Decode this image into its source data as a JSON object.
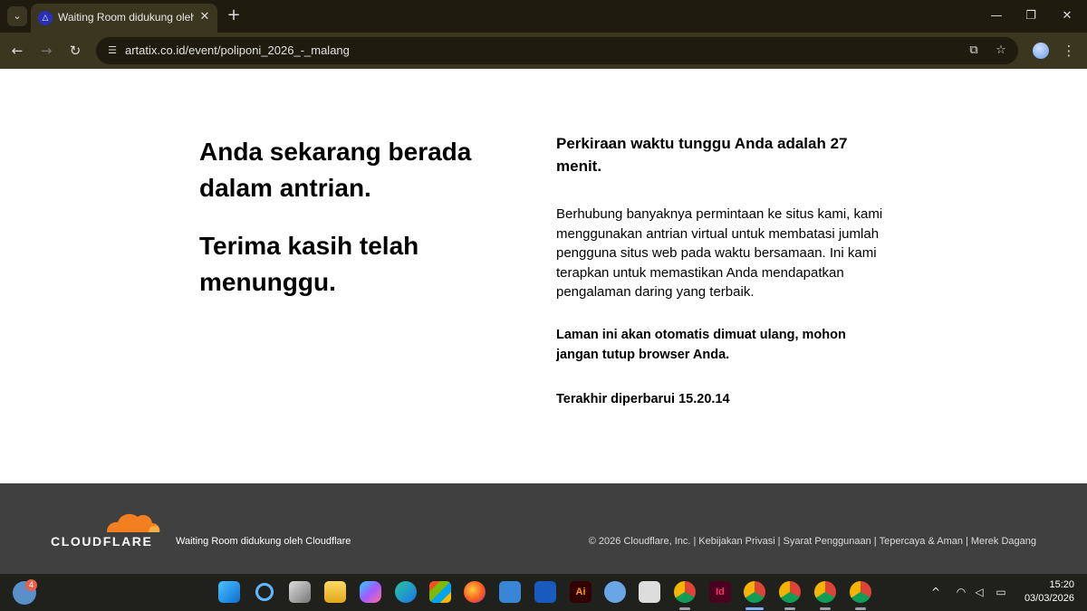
{
  "browser": {
    "tab_title": "Waiting Room didukung oleh Cloudflare",
    "url": "artatix.co.id/event/poliponi_2026_-_malang"
  },
  "page": {
    "heading_queue": "Anda sekarang berada dalam antrian.",
    "heading_thanks": "Terima kasih telah menunggu.",
    "wait_time": "Perkiraan waktu tunggu Anda adalah 27 menit.",
    "description": "Berhubung banyaknya permintaan ke situs kami, kami menggunakan antrian virtual untuk membatasi jumlah pengguna situs web pada waktu bersamaan. Ini kami terapkan untuk memastikan Anda mendapatkan pengalaman daring yang terbaik.",
    "auto_reload": "Laman ini akan otomatis dimuat ulang, mohon jangan tutup browser Anda.",
    "last_updated": "Terakhir diperbarui 15.20.14"
  },
  "footer": {
    "logo_text": "CLOUDFLARE",
    "powered_by": "Waiting Room didukung oleh Cloudflare",
    "copyright": "© 2026 Cloudflare, Inc.",
    "links": [
      "Kebijakan Privasi",
      "Syarat Penggunaan",
      "Tepercaya & Aman",
      "Merek Dagang"
    ],
    "brand_orange": "#f38020"
  },
  "taskbar": {
    "widget_badge": "4",
    "time": "15:20",
    "date": "03/03/2026"
  }
}
